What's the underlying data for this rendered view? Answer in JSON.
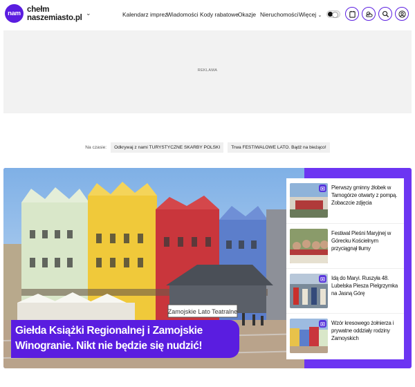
{
  "logo": {
    "badge": "nam",
    "line1": "chełm",
    "line2": "naszemiasto.pl"
  },
  "nav": {
    "items": [
      "Kalendarz imprez",
      "Wiadomości",
      "Kody rabatowe",
      "Okazje",
      "Nieruchomości",
      "Więcej"
    ]
  },
  "header_icons": [
    "theme-toggle",
    "newspaper-icon",
    "weather-icon",
    "search-icon",
    "user-icon"
  ],
  "ad": {
    "label": "REKLAMA"
  },
  "trending": {
    "label": "Na czasie:",
    "items": [
      "Odkrywaj z nami TURYSTYCZNE SKARBY POLSKI",
      "Trwa FESTIWALOWE LATO. Bądź na bieżąco!"
    ]
  },
  "hero": {
    "title_line1": "Giełda Książki Regionalnej i Zamojskie",
    "title_line2": "Winogranie. Nikt nie będzie się nudzić!",
    "sign_text": "Zamojskie Lato Teatralne"
  },
  "side_articles": [
    {
      "title": "Pierwszy gminny żłobek w Tarnogórze otwarty z pompą. Zobaczcie zdjęcia",
      "has_gallery": true
    },
    {
      "title": "Festiwal Pieśni Maryjnej w Górecku Kościelnym przyciągnął tłumy",
      "has_gallery": false
    },
    {
      "title": "Idą do Maryi. Ruszyła 48. Lubelska Piesza Pielgrzymka na Jasną Górę",
      "has_gallery": true
    },
    {
      "title": "Wzór kresowego żołnierza i prywatne oddziały rodziny Zamoyskich",
      "has_gallery": true
    }
  ],
  "colors": {
    "brand": "#5a1de0",
    "accent": "#6c35f2"
  }
}
